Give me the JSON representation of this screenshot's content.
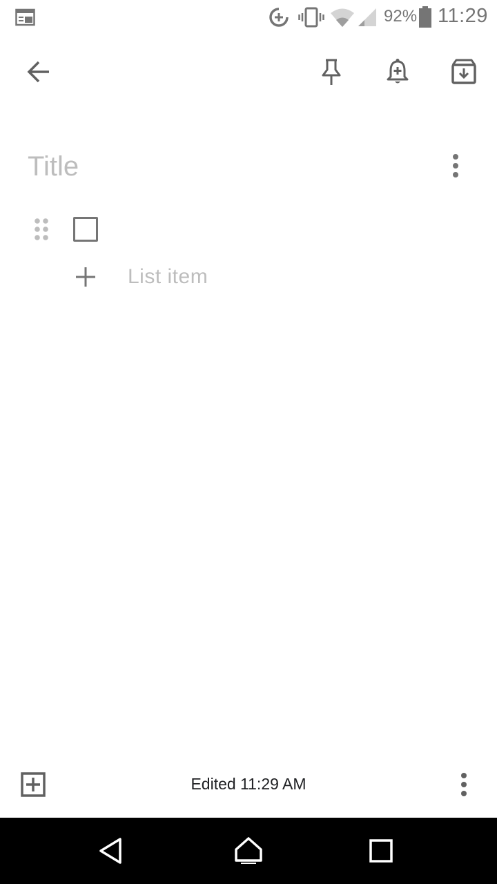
{
  "status_bar": {
    "battery_percent": "92%",
    "time": "11:29",
    "icons": [
      "calendar-icon",
      "data-saver-icon",
      "vibrate-icon",
      "wifi-icon",
      "signal-icon",
      "battery-icon"
    ]
  },
  "toolbar": {
    "icons": [
      "back-arrow-icon",
      "pin-icon",
      "reminder-bell-icon",
      "archive-icon"
    ]
  },
  "note": {
    "title_placeholder": "Title",
    "title_value": "",
    "add_item_label": "List item"
  },
  "bottom_bar": {
    "edited_text": "Edited 11:29 AM",
    "icons": [
      "add-box-icon",
      "more-vert-icon"
    ]
  },
  "nav_bar": {
    "icons": [
      "nav-back-icon",
      "nav-home-icon",
      "nav-recents-icon"
    ]
  },
  "colors": {
    "icon_gray": "#757575",
    "placeholder_gray": "#bdbdbd",
    "text_dark": "#202124",
    "nav_bar_bg": "#000000"
  }
}
